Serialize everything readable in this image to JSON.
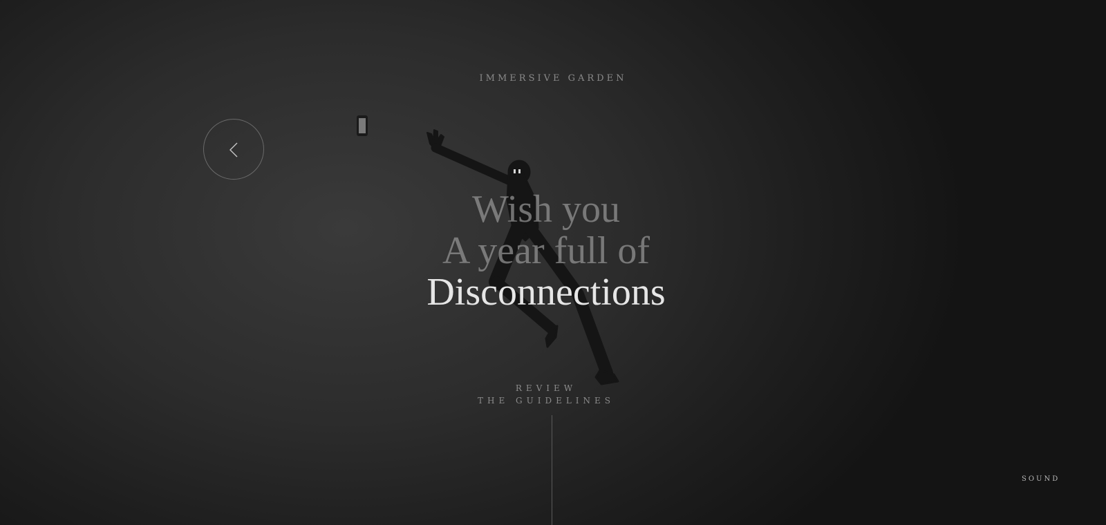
{
  "brand": {
    "name": "IMMERSIVE GARDEN"
  },
  "navigation": {
    "back_icon": "chevron-left-icon"
  },
  "headline": {
    "line1": "Wish you",
    "line2": "A year full of",
    "line3": "Disconnections"
  },
  "cta": {
    "line1": "REVIEW",
    "line2": "THE GUIDELINES"
  },
  "sound": {
    "label": "SOUND"
  },
  "illustration": {
    "figure_icon": "leaping-figure-icon",
    "phone_icon": "phone-icon"
  },
  "colors": {
    "background": "#2c2c2c",
    "text_dim": "#8a8a8a",
    "text_bright": "#e6e6e6",
    "figure": "#151515"
  }
}
